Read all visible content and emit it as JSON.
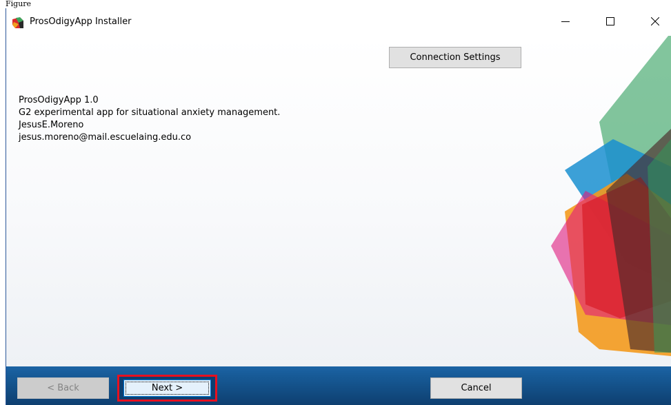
{
  "caption": "Figure",
  "window": {
    "title": "ProsOdigyApp Installer",
    "controls": {
      "minimize_icon": "minimize-icon",
      "maximize_icon": "maximize-icon",
      "close_icon": "close-icon"
    }
  },
  "content": {
    "connection_settings_label": "Connection Settings",
    "info": {
      "app_name": "ProsOdigyApp 1.0",
      "description": "G2 experimental app for situational anxiety management.",
      "author": "JesusE.Moreno",
      "email": "jesus.moreno@mail.escuelaing.edu.co"
    }
  },
  "footer": {
    "back_label": "< Back",
    "next_label": "Next >",
    "cancel_label": "Cancel"
  },
  "colors": {
    "footer_blue": "#15558f",
    "highlight_red": "#e8101f",
    "shape_green": "#2e9e5b",
    "shape_blue": "#1a8fd0",
    "shape_orange": "#f39a1e",
    "shape_red": "#d91f2a",
    "shape_magenta": "#e0197d",
    "shape_dark": "#4a2a2a"
  }
}
